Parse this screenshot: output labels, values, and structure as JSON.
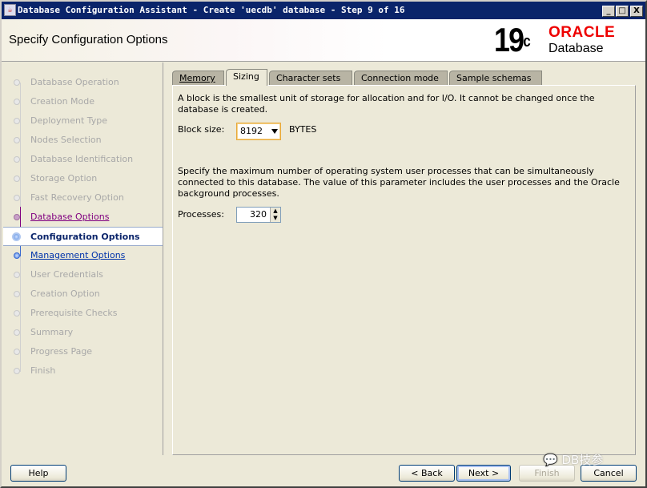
{
  "window": {
    "title": "Database Configuration Assistant - Create 'uecdb' database - Step 9 of 16",
    "controls": [
      "_",
      "□",
      "X"
    ]
  },
  "header": {
    "title": "Specify Configuration Options",
    "logo": {
      "version": "19",
      "suffix": "c",
      "brand": "ORACLE",
      "product": "Database"
    }
  },
  "steps": [
    {
      "label": "Database Operation",
      "state": "disabled"
    },
    {
      "label": "Creation Mode",
      "state": "disabled"
    },
    {
      "label": "Deployment Type",
      "state": "disabled"
    },
    {
      "label": "Nodes Selection",
      "state": "disabled"
    },
    {
      "label": "Database Identification",
      "state": "disabled"
    },
    {
      "label": "Storage Option",
      "state": "disabled"
    },
    {
      "label": "Fast Recovery Option",
      "state": "disabled"
    },
    {
      "label": "Database Options",
      "state": "visited"
    },
    {
      "label": "Configuration Options",
      "state": "current"
    },
    {
      "label": "Management Options",
      "state": "link"
    },
    {
      "label": "User Credentials",
      "state": "disabled"
    },
    {
      "label": "Creation Option",
      "state": "disabled"
    },
    {
      "label": "Prerequisite Checks",
      "state": "disabled"
    },
    {
      "label": "Summary",
      "state": "disabled"
    },
    {
      "label": "Progress Page",
      "state": "disabled"
    },
    {
      "label": "Finish",
      "state": "disabled"
    }
  ],
  "tabs": [
    {
      "label": "Memory",
      "active": false
    },
    {
      "label": "Sizing",
      "active": true
    },
    {
      "label": "Character sets",
      "active": false
    },
    {
      "label": "Connection mode",
      "active": false
    },
    {
      "label": "Sample schemas",
      "active": false
    }
  ],
  "sizing": {
    "block_desc": "A block is the smallest unit of storage for allocation and for I/O. It cannot be changed once the database is created.",
    "block_label": "Block size:",
    "block_value": "8192",
    "block_unit": "BYTES",
    "proc_desc": "Specify the maximum number of operating system user processes that can be simultaneously connected to this database. The value of this parameter includes the user processes and the Oracle background processes.",
    "proc_label": "Processes:",
    "proc_value": "320"
  },
  "buttons": {
    "help": "Help",
    "back": "< Back",
    "next": "Next >",
    "finish": "Finish",
    "cancel": "Cancel"
  },
  "watermark": "DB技参"
}
